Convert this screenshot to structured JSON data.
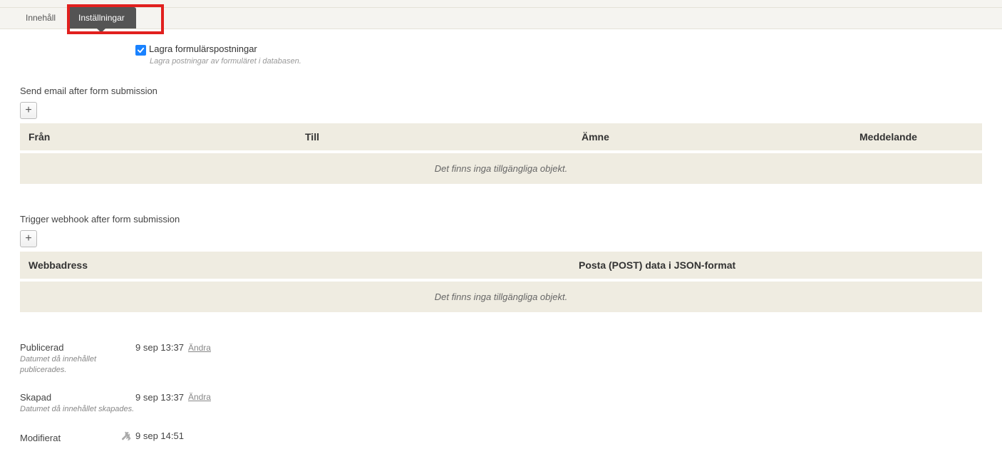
{
  "tabs": {
    "content": "Innehåll",
    "settings": "Inställningar"
  },
  "storeSubmissions": {
    "label": "Lagra formulärspostningar",
    "helper": "Lagra postningar av formuläret i databasen."
  },
  "emailSection": {
    "title": "Send email after form submission",
    "headers": {
      "from": "Från",
      "to": "Till",
      "subject": "Ämne",
      "message": "Meddelande"
    },
    "empty": "Det finns inga tillgängliga objekt."
  },
  "webhookSection": {
    "title": "Trigger webhook after form submission",
    "headers": {
      "url": "Webbadress",
      "post": "Posta (POST) data i JSON-format"
    },
    "empty": "Det finns inga tillgängliga objekt."
  },
  "meta": {
    "published": {
      "label": "Publicerad",
      "desc": "Datumet då innehållet publicerades.",
      "value": "9 sep 13:37",
      "change": "Ändra"
    },
    "created": {
      "label": "Skapad",
      "desc": "Datumet då innehållet skapades.",
      "value": "9 sep 13:37",
      "change": "Ändra"
    },
    "modified": {
      "label": "Modifierat",
      "value": "9 sep 14:51"
    }
  }
}
